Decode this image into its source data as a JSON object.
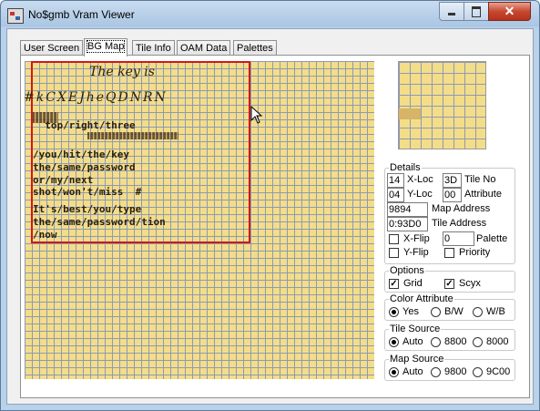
{
  "window": {
    "title": "No$gmb Vram Viewer"
  },
  "tabs": [
    {
      "label": "User Screen",
      "active": false
    },
    {
      "label": "BG Map",
      "active": true
    },
    {
      "label": "Tile Info",
      "active": false
    },
    {
      "label": "OAM Data",
      "active": false
    },
    {
      "label": "Palettes",
      "active": false
    }
  ],
  "map_text": {
    "line1": "The key is",
    "line2": "#kCXEJheQDNRN",
    "line3": "  top/right/three",
    "line4": "/you/hit/the/key",
    "line5": "the/same/password",
    "line6": "or/my/next",
    "line7": "shot/won't/miss  #",
    "line8": "It's/best/you/type",
    "line9": "the/same/password/tion",
    "line10": "/now"
  },
  "details": {
    "legend": "Details",
    "xloc_value": "14",
    "xloc_label": "X-Loc",
    "tileno_value": "3D",
    "tileno_label": "Tile No",
    "yloc_value": "04",
    "yloc_label": "Y-Loc",
    "attr_value": "00",
    "attr_label": "Attribute",
    "map_addr_value": "9894",
    "map_addr_label": "Map Address",
    "tile_addr_value": "0:93D0",
    "tile_addr_label": "Tile Address",
    "xflip_label": "X-Flip",
    "xflip_checked": false,
    "palette_value": "0",
    "palette_label": "Palette",
    "yflip_label": "Y-Flip",
    "yflip_checked": false,
    "priority_label": "Priority",
    "priority_checked": false
  },
  "options": {
    "legend": "Options",
    "grid_label": "Grid",
    "grid_checked": true,
    "scyx_label": "Scyx",
    "scyx_checked": true
  },
  "color_attribute": {
    "legend": "Color Attribute",
    "options": [
      "Yes",
      "B/W",
      "W/B"
    ],
    "selected": "Yes"
  },
  "tile_source": {
    "legend": "Tile Source",
    "options": [
      "Auto",
      "8800",
      "8000"
    ],
    "selected": "Auto"
  },
  "map_source": {
    "legend": "Map Source",
    "options": [
      "Auto",
      "9800",
      "9C00"
    ],
    "selected": "Auto"
  },
  "colors": {
    "map_bg": "#f4dd88",
    "grid": "#8c9ab8",
    "viewport": "#d01818"
  }
}
